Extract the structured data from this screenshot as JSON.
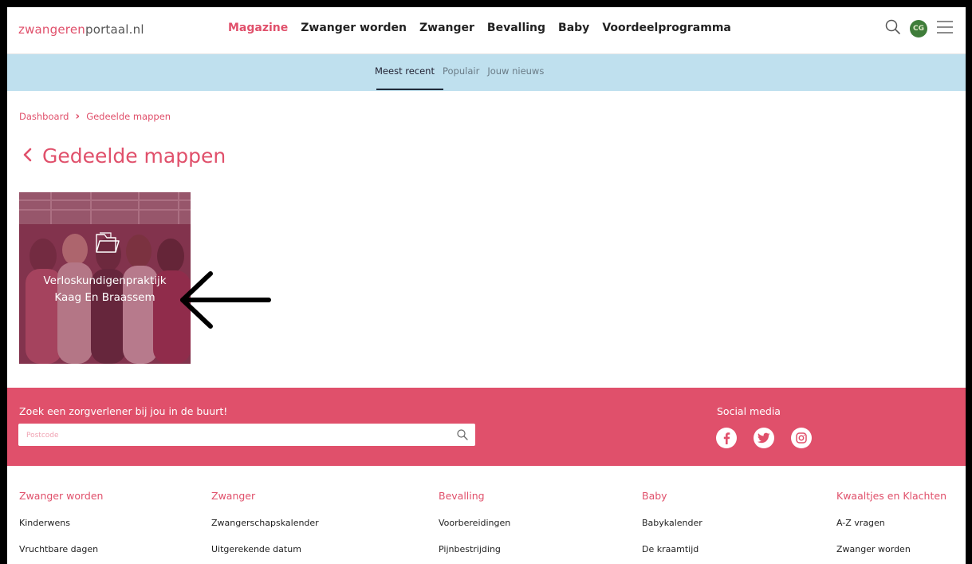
{
  "header": {
    "logo_part1": "zwangeren",
    "logo_part2": "portaal.nl",
    "nav": [
      "Magazine",
      "Zwanger worden",
      "Zwanger",
      "Bevalling",
      "Baby",
      "Voordeelprogramma"
    ],
    "avatar_initials": "CG",
    "icons": [
      "search-icon",
      "avatar",
      "menu-icon"
    ]
  },
  "subnav": {
    "items": [
      "Meest recent",
      "Populair",
      "Jouw nieuws"
    ],
    "active": "Meest recent"
  },
  "breadcrumb": {
    "items": [
      "Dashboard",
      "Gedeelde mappen"
    ]
  },
  "page": {
    "title": "Gedeelde mappen"
  },
  "folder_card": {
    "line1": "Verloskundigenpraktijk",
    "line2": "Kaag En Braassem"
  },
  "band": {
    "search_title": "Zoek een zorgverlener bij jou in de buurt!",
    "search_placeholder": "Postcode",
    "social_title": "Social media",
    "social_icons": [
      "facebook-icon",
      "twitter-icon",
      "instagram-icon"
    ]
  },
  "footer": {
    "columns": [
      {
        "heading": "Zwanger worden",
        "links": [
          "Kinderwens",
          "Vruchtbare dagen"
        ]
      },
      {
        "heading": "Zwanger",
        "links": [
          "Zwangerschapskalender",
          "Uitgerekende datum"
        ]
      },
      {
        "heading": "Bevalling",
        "links": [
          "Voorbereidingen",
          "Pijnbestrijding"
        ]
      },
      {
        "heading": "Baby",
        "links": [
          "Babykalender",
          "De kraamtijd"
        ]
      },
      {
        "heading": "Kwaaltjes en Klachten",
        "links": [
          "A-Z vragen",
          "Zwanger worden"
        ]
      }
    ]
  },
  "colors": {
    "brand_pink": "#e0506b",
    "subnav_blue": "#bfe0ee"
  }
}
